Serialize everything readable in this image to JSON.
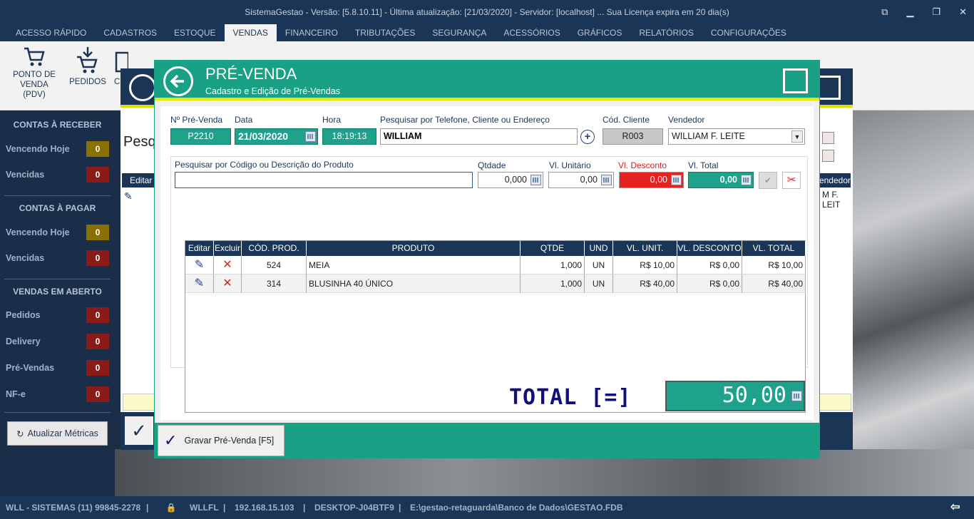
{
  "window": {
    "title": "SistemaGestao - Versão: [5.8.10.11] - Última atualização: [21/03/2020] - Servidor: [localhost] ... Sua Licença expira em 20 dia(s)"
  },
  "menu": [
    "ACESSO RÁPIDO",
    "CADASTROS",
    "ESTOQUE",
    "VENDAS",
    "FINANCEIRO",
    "TRIBUTAÇÕES",
    "SEGURANÇA",
    "ACESSÓRIOS",
    "GRÁFICOS",
    "RELATÓRIOS",
    "CONFIGURAÇÕES"
  ],
  "ribbon": {
    "pdv_line1": "PONTO DE",
    "pdv_line2": "VENDA (PDV)",
    "pedidos": "PEDIDOS",
    "partial_c": "C"
  },
  "sidebar": {
    "receber_head": "CONTAS À RECEBER",
    "pagar_head": "CONTAS À PAGAR",
    "abertas_head": "VENDAS EM ABERTO",
    "vencendo_hoje": "Vencendo Hoje",
    "vencidas": "Vencidas",
    "r_hoje": "0",
    "r_venc": "0",
    "p_hoje": "0",
    "p_venc": "0",
    "pedidos": "Pedidos",
    "delivery": "Delivery",
    "prevendas": "Pré-Vendas",
    "nfe": "NF-e",
    "pedidos_n": "0",
    "delivery_n": "0",
    "prevendas_n": "0",
    "nfe_n": "0",
    "refresh": "Atualizar Métricas"
  },
  "backwin": {
    "search": "Pesq",
    "col_editar": "Editar",
    "col_vendedor": "Vendedor",
    "cell_vendedor": "M F. LEIT"
  },
  "dialog": {
    "title": "PRÉ-VENDA",
    "subtitle": "Cadastro e Edição de Pré-Vendas",
    "lbl_num": "Nº Pré-Venda",
    "lbl_data": "Data",
    "lbl_hora": "Hora",
    "lbl_pesq": "Pesquisar por Telefone, Cliente ou Endereço",
    "lbl_cod": "Cód. Cliente",
    "lbl_vend": "Vendedor",
    "num": "P2210",
    "data": "21/03/2020",
    "hora": "18:19:13",
    "cliente": "WILLIAM",
    "cod": "R003",
    "vendedor": "WILLIAM F. LEITE",
    "lbl_prod": "Pesquisar por Código ou Descrição do Produto",
    "lbl_qtd": "Qtdade",
    "lbl_unit": "Vl. Unitário",
    "lbl_desc": "Vl. Desconto",
    "lbl_total": "Vl. Total",
    "prod": "",
    "qtd": "0,000",
    "unit": "0,00",
    "desc": "0,00",
    "vtotal": "0,00",
    "columns": [
      "Editar",
      "Excluir",
      "CÓD. PROD.",
      "PRODUTO",
      "QTDE",
      "UND",
      "VL. UNIT.",
      "VL. DESCONTO",
      "VL. TOTAL"
    ],
    "rows": [
      {
        "cod": "524",
        "produto": "MEIA",
        "qtde": "1,000",
        "und": "UN",
        "unit": "R$ 10,00",
        "desc": "R$ 0,00",
        "total": "R$ 10,00"
      },
      {
        "cod": "314",
        "produto": "BLUSINHA 40 ÚNICO",
        "qtde": "1,000",
        "und": "UN",
        "unit": "R$ 40,00",
        "desc": "R$ 0,00",
        "total": "R$ 40,00"
      }
    ],
    "total_label": "TOTAL [=]",
    "total_value": "50,00",
    "save": "Gravar Pré-Venda [F5]"
  },
  "status": {
    "company": "WLL - SISTEMAS (11) 99845-2278",
    "user": "WLLFL",
    "ip": "192.168.15.103",
    "host": "DESKTOP-J04BTF9",
    "db": "E:\\gestao-retaguarda\\Banco de Dados\\GESTAO.FDB"
  }
}
